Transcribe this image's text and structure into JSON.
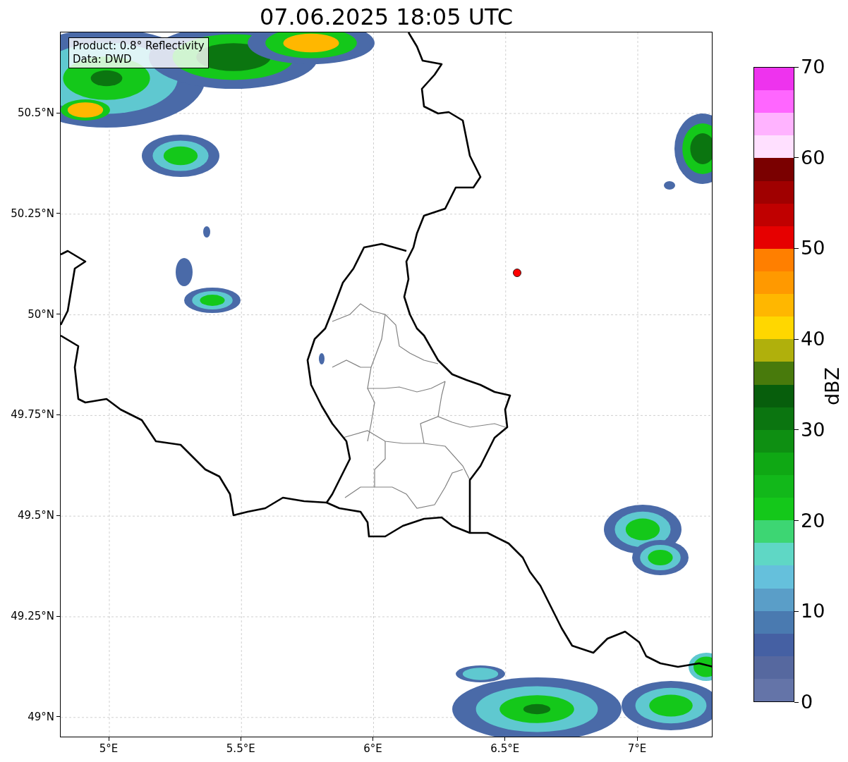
{
  "title": "07.06.2025 18:05 UTC",
  "info_box": {
    "lines": [
      "Product: 0.8° Reflectivity",
      "Data: DWD"
    ]
  },
  "x_axis": {
    "ticks": [
      "5°E",
      "5.5°E",
      "6°E",
      "6.5°E",
      "7°E"
    ]
  },
  "y_axis": {
    "ticks": [
      "50.5°N",
      "50.25°N",
      "50°N",
      "49.75°N",
      "49.5°N",
      "49.25°N",
      "49°N"
    ]
  },
  "colorbar": {
    "label": "dBZ",
    "ticks": [
      "70",
      "60",
      "50",
      "40",
      "30",
      "20",
      "10",
      "0"
    ],
    "bins": [
      {
        "color": "#ee33ee"
      },
      {
        "color": "#ff66ff"
      },
      {
        "color": "#ffb3ff"
      },
      {
        "color": "#ffe0ff"
      },
      {
        "color": "#7a0000"
      },
      {
        "color": "#a00000"
      },
      {
        "color": "#c00000"
      },
      {
        "color": "#e60000"
      },
      {
        "color": "#ff7f00"
      },
      {
        "color": "#ff9900"
      },
      {
        "color": "#ffb700"
      },
      {
        "color": "#ffd700"
      },
      {
        "color": "#b0b00c"
      },
      {
        "color": "#487a0c"
      },
      {
        "color": "#075e0c"
      },
      {
        "color": "#0b7510"
      },
      {
        "color": "#0e8f12"
      },
      {
        "color": "#0fa814"
      },
      {
        "color": "#12b81a"
      },
      {
        "color": "#14c81a"
      },
      {
        "color": "#3dd673"
      },
      {
        "color": "#5fd7c5"
      },
      {
        "color": "#65c0dc"
      },
      {
        "color": "#5a9ec8"
      },
      {
        "color": "#4a7ab0"
      },
      {
        "color": "#4560a3"
      },
      {
        "color": "#56689f"
      },
      {
        "color": "#6474a8"
      }
    ]
  }
}
